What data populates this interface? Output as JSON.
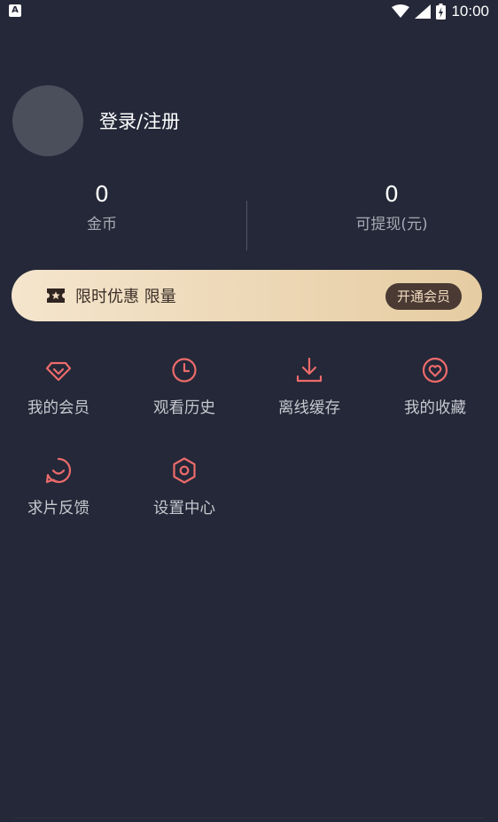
{
  "status_bar": {
    "notification_glyph": "A",
    "time": "10:00",
    "icons": [
      "wifi-icon",
      "signal-icon",
      "battery-icon"
    ]
  },
  "profile": {
    "login_label": "登录/注册"
  },
  "stats": {
    "coins": {
      "value": "0",
      "label": "金币"
    },
    "withdrawable": {
      "value": "0",
      "label": "可提现(元)"
    }
  },
  "promo": {
    "text": "限时优惠 限量",
    "button_label": "开通会员",
    "icon": "ticket-star-icon"
  },
  "menu": [
    {
      "label": "我的会员",
      "icon": "diamond-icon"
    },
    {
      "label": "观看历史",
      "icon": "clock-icon"
    },
    {
      "label": "离线缓存",
      "icon": "download-icon"
    },
    {
      "label": "我的收藏",
      "icon": "heart-icon"
    },
    {
      "label": "求片反馈",
      "icon": "smile-chat-icon"
    },
    {
      "label": "设置中心",
      "icon": "hexagon-gear-icon"
    }
  ],
  "colors": {
    "background": "#242838",
    "icon_accent": "#ec6b6b",
    "promo_gradient_start": "#f4e5cd",
    "promo_gradient_end": "#e6cca2",
    "promo_button": "#4a3a33",
    "label_gray": "#c6c8ce"
  }
}
